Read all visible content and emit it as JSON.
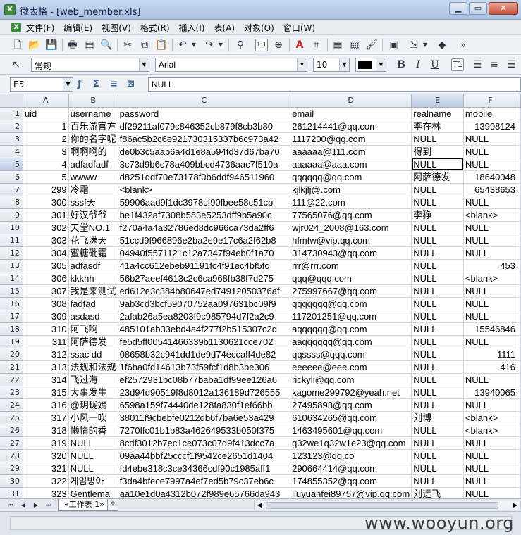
{
  "window": {
    "title": "微表格 - [web_member.xls]",
    "app_icon": "spreadsheet-app-icon"
  },
  "menu": [
    "文件(F)",
    "编辑(E)",
    "视图(V)",
    "格式(R)",
    "插入(I)",
    "表(A)",
    "对象(O)",
    "窗口(W)"
  ],
  "toolbar": {
    "style_value": "常规",
    "font_value": "Arial",
    "size_value": "10",
    "text_color": "#000000"
  },
  "formula_bar": {
    "cell_ref": "E5",
    "content": "NULL"
  },
  "columns": [
    "A",
    "B",
    "C",
    "D",
    "E",
    "F"
  ],
  "header_row": {
    "num": "1",
    "cells": [
      "uid",
      "username",
      "password",
      "email",
      "realname",
      "mobile"
    ]
  },
  "rows": [
    {
      "num": "2",
      "cells": [
        "1",
        "百乐游官方",
        "df29211af079c846352cb879f8cb3b80",
        "261214441@qq.com",
        "李在林",
        "13998124"
      ]
    },
    {
      "num": "3",
      "cells": [
        "2",
        "你的名字呢",
        "f86ac5b2c6e921730315337b6c973a42",
        "1117200@qq.com",
        "NULL",
        "NULL"
      ]
    },
    {
      "num": "4",
      "cells": [
        "3",
        "啊啊啊的",
        "de0b3c5aab6a4d1e8a594fd37d67ba70",
        "aaaaaa@111.com",
        "得到",
        "NULL"
      ]
    },
    {
      "num": "5",
      "cells": [
        "4",
        "adfadfadf",
        "3c73d9b6c78a409bbcd4736aac7f510a",
        "aaaaaa@aaa.com",
        "NULL",
        "NULL"
      ]
    },
    {
      "num": "6",
      "cells": [
        "5",
        "wwww",
        "d8251ddf70e73178f0b6ddf946511960",
        "qqqqqq@qq.com",
        "阿萨德发",
        "18640048"
      ]
    },
    {
      "num": "7",
      "cells": [
        "299",
        "冷霜",
        "<blank>",
        "kjlkjlj@.com",
        "NULL",
        "65438653"
      ]
    },
    {
      "num": "8",
      "cells": [
        "300",
        "sssf天",
        "59906aad9f1dc3978cf90fbee58c51cb",
        "111@22.com",
        "NULL",
        "NULL"
      ]
    },
    {
      "num": "9",
      "cells": [
        "301",
        "好汉爷爷",
        "be1f432af7308b583e5253dff9b5a90c",
        "77565076@qq.com",
        "李狰",
        "<blank>"
      ]
    },
    {
      "num": "10",
      "cells": [
        "302",
        "天堂NO.1",
        "f270a4a4a32786ed8dc966ca73da2ff6",
        "wjr024_2008@163.com",
        "NULL",
        "NULL"
      ]
    },
    {
      "num": "11",
      "cells": [
        "303",
        "花飞满天",
        "51ccd9f966896e2ba2e9e17c6a2f62b8",
        "hfmtw@vip.qq.com",
        "NULL",
        "NULL"
      ]
    },
    {
      "num": "12",
      "cells": [
        "304",
        "蜜糖砒霜",
        "04940f5571121c12a7347f94eb0f1a70",
        "314730943@qq.com",
        "NULL",
        "NULL"
      ]
    },
    {
      "num": "13",
      "cells": [
        "305",
        "adfasdf",
        "41a4cc612ebeb91191fc4f91ec4bf5fc",
        "rrr@rrr.com",
        "NULL",
        "453"
      ]
    },
    {
      "num": "14",
      "cells": [
        "306",
        "kkkhh",
        "56b27aeef4613c2c6ca968fb38f7d275",
        "qqq@qqq.com",
        "NULL",
        "<blank>"
      ]
    },
    {
      "num": "15",
      "cells": [
        "307",
        "我是来测试",
        "ed612e3c384b80647ed74912050376af",
        "275997667@qq.com",
        "NULL",
        "NULL"
      ]
    },
    {
      "num": "16",
      "cells": [
        "308",
        "fadfad",
        "9ab3cd3bcf59070752aa097631bc09f9",
        "qqqqqqq@qq.com",
        "NULL",
        "NULL"
      ]
    },
    {
      "num": "17",
      "cells": [
        "309",
        "asdasd",
        "2afab26a5ea8203f9c985794d7f2a2c9",
        "117201251@qq.com",
        "NULL",
        "NULL"
      ]
    },
    {
      "num": "18",
      "cells": [
        "310",
        "阿飞啊",
        "485101ab33ebd4a4f277f2b515307c2d",
        "aqqqqqq@qq.com",
        "NULL",
        "15546846"
      ]
    },
    {
      "num": "19",
      "cells": [
        "311",
        "阿萨德发",
        "fe5d5ff00541466339b1130621cce702",
        "aaqqqqqq@qq.com",
        "NULL",
        "NULL"
      ]
    },
    {
      "num": "20",
      "cells": [
        "312",
        "ssac dd",
        "08658b32c941dd1de9d74eccaff4de82",
        "qqssss@qqq.com",
        "NULL",
        "1111"
      ]
    },
    {
      "num": "21",
      "cells": [
        "313",
        "法规和法规",
        "1f6ba0fd14613b73f59fcf1d8b3be306",
        "eeeeee@eee.com",
        "NULL",
        "416"
      ]
    },
    {
      "num": "22",
      "cells": [
        "314",
        "飞过海",
        "ef2572931bc08b77baba1df99ee126a6",
        "rickyli@qq.com",
        "NULL",
        "NULL"
      ]
    },
    {
      "num": "23",
      "cells": [
        "315",
        "大事发生",
        "23d94d90519f8d8012a136189d726555",
        "kagome299792@yeah.net",
        "NULL",
        "13940065"
      ]
    },
    {
      "num": "24",
      "cells": [
        "316",
        "@玥珑嫣",
        "6598a159f74440de128fa830f1ef66bb",
        "27495893@qq.com",
        "NULL",
        "NULL"
      ]
    },
    {
      "num": "25",
      "cells": [
        "317",
        "小风一吹",
        "38011f9cbebfe0212db6f7ba6e53a429",
        "610634265@qq.com",
        "刘博",
        "<blank>"
      ]
    },
    {
      "num": "26",
      "cells": [
        "318",
        "懒惰的香",
        "7270ffc01b1b83a462649533b050f375",
        "1463495601@qq.com",
        "NULL",
        "<blank>"
      ]
    },
    {
      "num": "27",
      "cells": [
        "319",
        "NULL",
        "8cdf3012b7ec1ce073c07d9f413dcc7a",
        "q32we1q32w1e23@qq.com",
        "NULL",
        "NULL"
      ]
    },
    {
      "num": "28",
      "cells": [
        "320",
        "NULL",
        "09aa44bbf25cccf1f9542ce2651d1404",
        "123123@qq.co",
        "NULL",
        "NULL"
      ]
    },
    {
      "num": "29",
      "cells": [
        "321",
        "NULL",
        "fd4ebe318c3ce34366cdf90c1985aff1",
        "290664414@qq.com",
        "NULL",
        "NULL"
      ]
    },
    {
      "num": "30",
      "cells": [
        "322",
        "게임방아",
        "f3da4bfece7997a4ef7ed5b79c37eb6c",
        "174855352@qq.com",
        "NULL",
        "NULL"
      ]
    },
    {
      "num": "31",
      "cells": [
        "323",
        "Gentlema",
        "aa10e1d0a4312b072f989e65766da943",
        "liuyuanfei89757@vip.qq.com",
        "刘远飞",
        "NULL"
      ]
    }
  ],
  "sheet_tabs": {
    "nav": [
      "⏮",
      "◀",
      "▶",
      "⏭"
    ],
    "active": "«工作表 1»",
    "add": "*"
  },
  "watermark": "www.wooyun.org"
}
